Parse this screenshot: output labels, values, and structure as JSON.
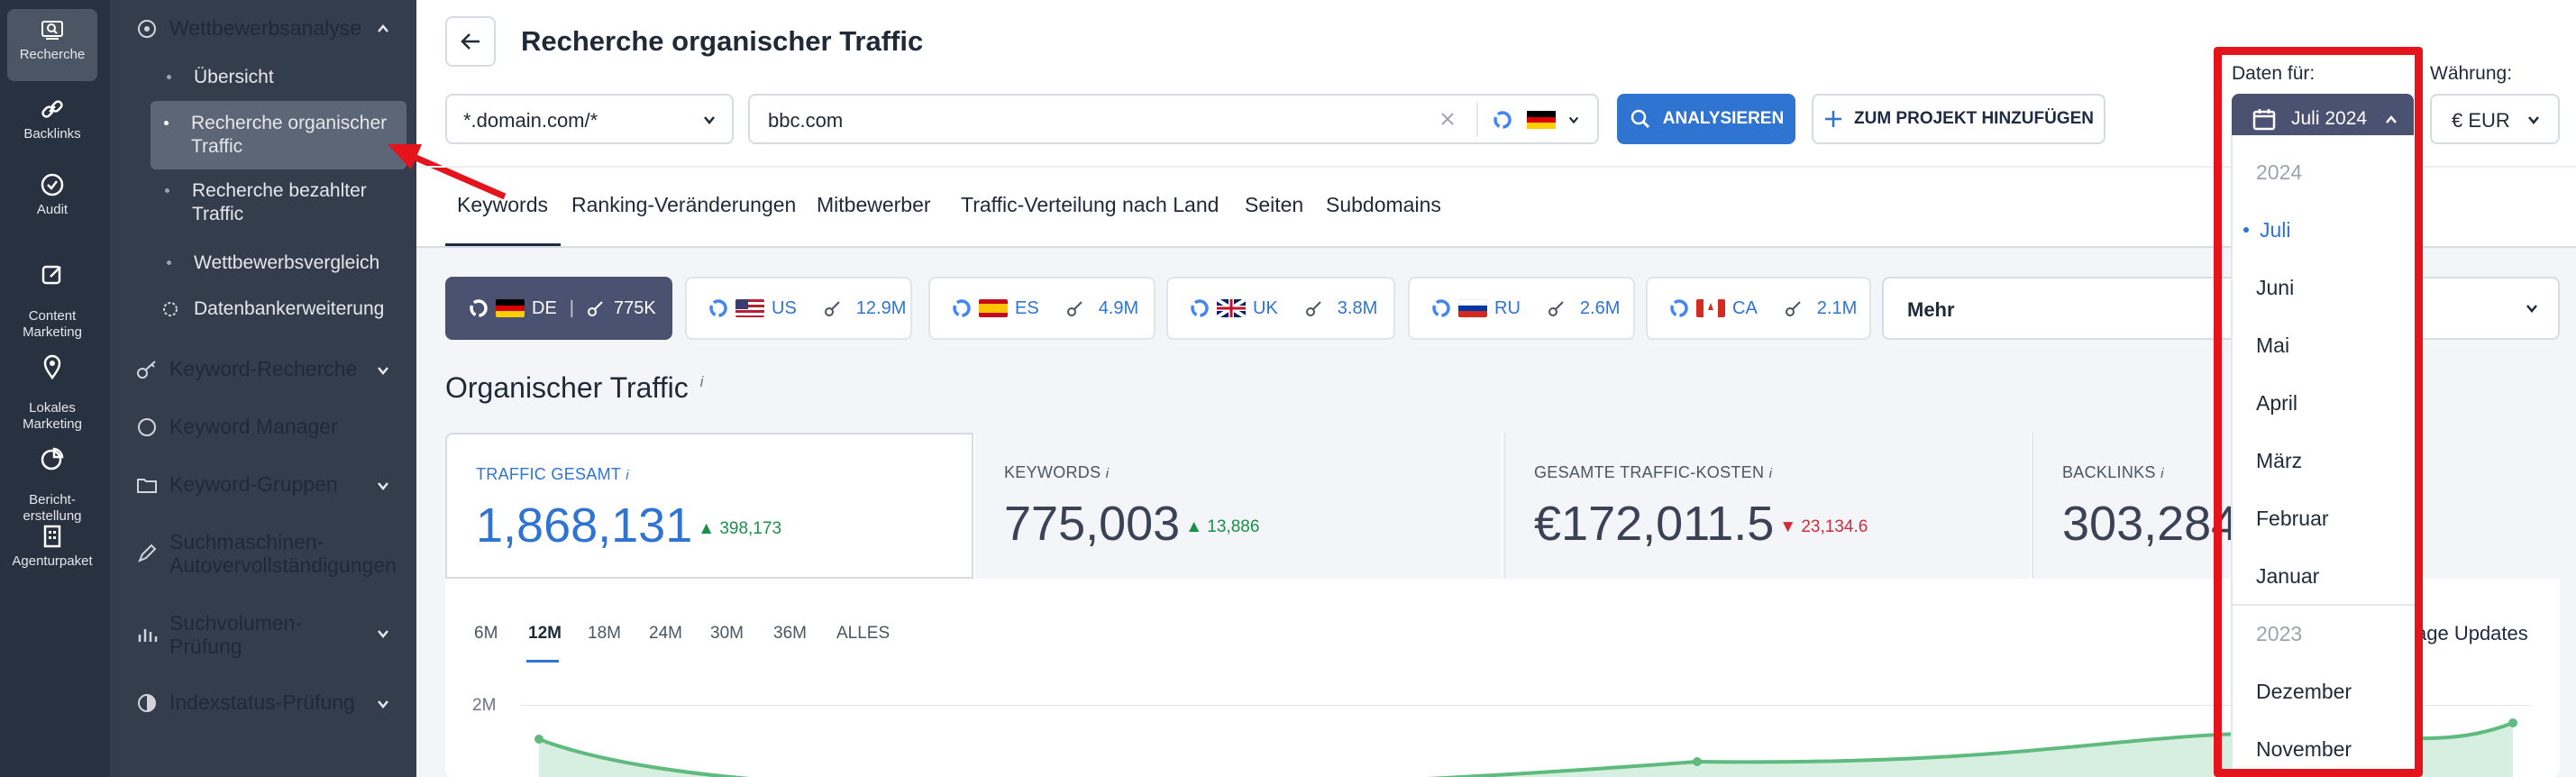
{
  "iconnav": {
    "items": [
      {
        "label": "Recherche",
        "icon": "search-icon"
      },
      {
        "label": "Backlinks",
        "icon": "link-icon"
      },
      {
        "label": "Audit",
        "icon": "check-circle-icon"
      },
      {
        "label": "Content\nMarketing",
        "icon": "edit-icon"
      },
      {
        "label": "Lokales\nMarketing",
        "icon": "map-pin-icon"
      },
      {
        "label": "Bericht-\nerstellung",
        "icon": "pie-chart-icon"
      },
      {
        "label": "Agenturpaket",
        "icon": "building-icon"
      }
    ]
  },
  "subnav": {
    "section": "Wettbewerbsanalyse",
    "sub": [
      "Übersicht",
      "Recherche organischer\nTraffic",
      "Recherche bezahlter\nTraffic",
      "Wettbewerbsvergleich",
      "Datenbankerweiterung"
    ],
    "items": [
      "Keyword-Recherche",
      "Keyword Manager",
      "Keyword-Gruppen",
      "Suchmaschinen-\nAutovervollständigungen",
      "Suchvolumen-\nPrüfung",
      "Indexstatus-Prüfung"
    ]
  },
  "header": {
    "title": "Recherche organischer Traffic"
  },
  "search": {
    "scope": "*.domain.com/*",
    "domain": "bbc.com",
    "analyze": "ANALYSIEREN",
    "add_project": "ZUM PROJEKT HINZUFÜGEN"
  },
  "date": {
    "label": "Daten für:",
    "value": "Juli 2024"
  },
  "currency": {
    "label": "Währung:",
    "value": "€ EUR"
  },
  "tabs": [
    "Keywords",
    "Ranking-Veränderungen",
    "Mitbewerber",
    "Traffic-Verteilung nach Land",
    "Seiten",
    "Subdomains"
  ],
  "countries": [
    {
      "code": "DE",
      "count": "775K"
    },
    {
      "code": "US",
      "count": "12.9M"
    },
    {
      "code": "ES",
      "count": "4.9M"
    },
    {
      "code": "UK",
      "count": "3.8M"
    },
    {
      "code": "RU",
      "count": "2.6M"
    },
    {
      "code": "CA",
      "count": "2.1M"
    }
  ],
  "more": "Mehr",
  "section_title": "Organischer Traffic",
  "info_mark": "i",
  "metrics": [
    {
      "label": "TRAFFIC GESAMT",
      "value": "1,868,131",
      "delta": "398,173",
      "dir": "up"
    },
    {
      "label": "KEYWORDS",
      "value": "775,003",
      "delta": "13,886",
      "dir": "up"
    },
    {
      "label": "GESAMTE TRAFFIC-KOSTEN",
      "value": "€172,011.5",
      "delta": "23,134.6",
      "dir": "down"
    },
    {
      "label": "BACKLINKS",
      "value": "303,284",
      "delta": "",
      "dir": ""
    }
  ],
  "ranges": [
    "6M",
    "12M",
    "18M",
    "24M",
    "30M",
    "36M",
    "ALLES"
  ],
  "selected_range": "12M",
  "updates_text": "age Updates",
  "chart_data": {
    "type": "area",
    "ytick": "2M"
  },
  "dropdown": {
    "year1": "2024",
    "months1": [
      "Juli",
      "Juni",
      "Mai",
      "April",
      "März",
      "Februar",
      "Januar"
    ],
    "year2": "2023",
    "months2": [
      "Dezember",
      "November"
    ]
  },
  "colors": {
    "accent": "#2f74d0",
    "sidebar": "#27313f",
    "up": "#1a8f4a",
    "down": "#d42a3a",
    "highlight": "#e5141c"
  }
}
